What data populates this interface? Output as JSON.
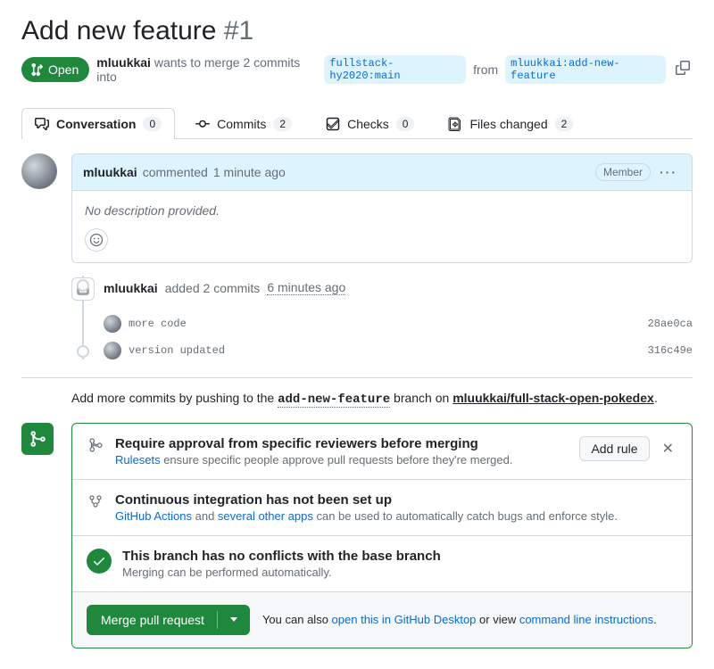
{
  "pr": {
    "title": "Add new feature",
    "number": "#1",
    "state_label": "Open",
    "author": "mluukkai",
    "wants_to_merge": " wants to merge 2 commits into ",
    "base_branch": "fullstack-hy2020:main",
    "from_word": " from ",
    "head_branch": "mluukkai:add-new-feature"
  },
  "tabs": {
    "conversation": {
      "label": "Conversation",
      "count": "0"
    },
    "commits": {
      "label": "Commits",
      "count": "2"
    },
    "checks": {
      "label": "Checks",
      "count": "0"
    },
    "files": {
      "label": "Files changed",
      "count": "2"
    }
  },
  "comment": {
    "author": "mluukkai",
    "verb": " commented ",
    "time": "1 minute ago",
    "badge": "Member",
    "body": "No description provided."
  },
  "push_event": {
    "author": "mluukkai",
    "text": " added 2 commits ",
    "time": "6 minutes ago"
  },
  "commits": [
    {
      "msg": "more code",
      "sha": "28ae0ca"
    },
    {
      "msg": "version updated",
      "sha": "316c49e"
    }
  ],
  "hint": {
    "prefix": "Add more commits by pushing to the ",
    "branch": "add-new-feature",
    "mid": " branch on ",
    "repo": "mluukkai/full-stack-open-pokedex",
    "suffix": "."
  },
  "merge": {
    "s1": {
      "title": "Require approval from specific reviewers before merging",
      "link": "Rulesets",
      "desc_rest": " ensure specific people approve pull requests before they're merged.",
      "button": "Add rule"
    },
    "s2": {
      "title": "Continuous integration has not been set up",
      "link1": "GitHub Actions",
      "mid": " and ",
      "link2": "several other apps",
      "rest": " can be used to automatically catch bugs and enforce style."
    },
    "s3": {
      "title": "This branch has no conflicts with the base branch",
      "desc": "Merging can be performed automatically."
    },
    "action": {
      "button": "Merge pull request",
      "prefix": "You can also ",
      "link1": "open this in GitHub Desktop",
      "mid": " or view ",
      "link2": "command line instructions",
      "suffix": "."
    }
  }
}
